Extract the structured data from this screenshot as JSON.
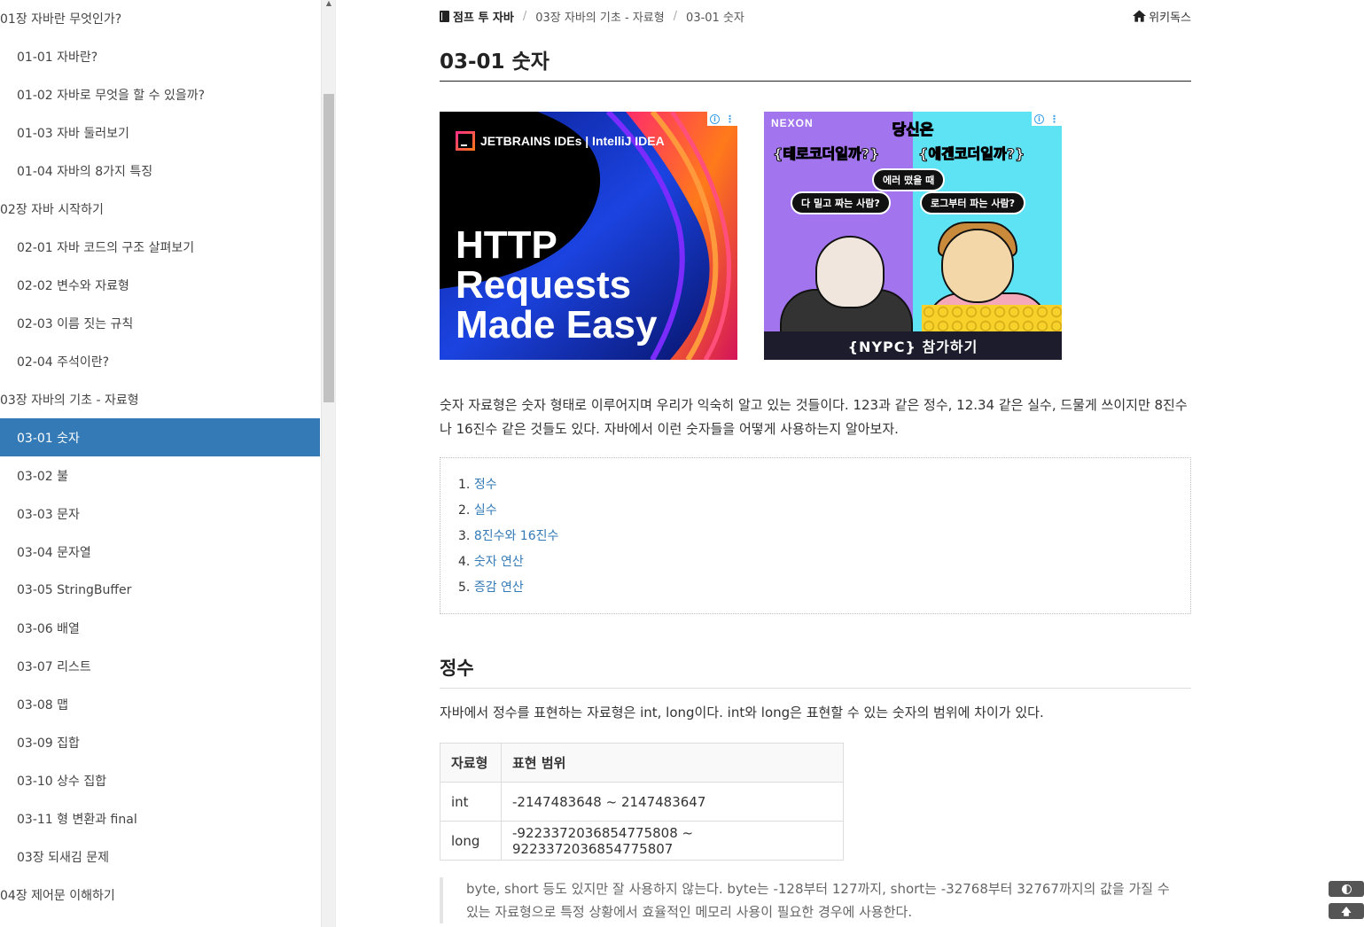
{
  "sidebar": {
    "items": [
      {
        "label": "01장 자바란 무엇인가?",
        "type": "chapter"
      },
      {
        "label": "01-01 자바란?",
        "type": "page"
      },
      {
        "label": "01-02 자바로 무엇을 할 수 있을까?",
        "type": "page"
      },
      {
        "label": "01-03 자바 둘러보기",
        "type": "page"
      },
      {
        "label": "01-04 자바의 8가지 특징",
        "type": "page"
      },
      {
        "label": "02장 자바 시작하기",
        "type": "chapter"
      },
      {
        "label": "02-01 자바 코드의 구조 살펴보기",
        "type": "page"
      },
      {
        "label": "02-02 변수와 자료형",
        "type": "page"
      },
      {
        "label": "02-03 이름 짓는 규칙",
        "type": "page"
      },
      {
        "label": "02-04 주석이란?",
        "type": "page"
      },
      {
        "label": "03장 자바의 기초 - 자료형",
        "type": "chapter"
      },
      {
        "label": "03-01 숫자",
        "type": "page",
        "active": true
      },
      {
        "label": "03-02 불",
        "type": "page"
      },
      {
        "label": "03-03 문자",
        "type": "page"
      },
      {
        "label": "03-04 문자열",
        "type": "page"
      },
      {
        "label": "03-05 StringBuffer",
        "type": "page"
      },
      {
        "label": "03-06 배열",
        "type": "page"
      },
      {
        "label": "03-07 리스트",
        "type": "page"
      },
      {
        "label": "03-08 맵",
        "type": "page"
      },
      {
        "label": "03-09 집합",
        "type": "page"
      },
      {
        "label": "03-10 상수 집합",
        "type": "page"
      },
      {
        "label": "03-11 형 변환과 final",
        "type": "page"
      },
      {
        "label": "03장 되새김 문제",
        "type": "page"
      },
      {
        "label": "04장 제어문 이해하기",
        "type": "chapter"
      }
    ]
  },
  "breadcrumb": {
    "book": "점프 투 자바",
    "chapter": "03장 자바의 기초 - 자료형",
    "page": "03-01 숫자",
    "home_label": "위키독스"
  },
  "page_title": "03-01 숫자",
  "ads": {
    "jetbrains": {
      "brand": "JETBRAINS IDEs  |  IntelliJ IDEA",
      "headline_lines": [
        "HTTP",
        "Requests",
        "Made Easy"
      ]
    },
    "nexon": {
      "brand": "NEXON",
      "title": "당신은",
      "left_question": "{테로코더일까?}",
      "right_question": "{에겐코더일까?}",
      "bubble_mid": "에러 떴을 때",
      "bubble_left": "다 밀고 짜는 사람?",
      "bubble_right": "로그부터 파는 사람?",
      "cta": "{NYPC} 참가하기"
    }
  },
  "intro": "숫자 자료형은 숫자 형태로 이루어지며 우리가 익숙히 알고 있는 것들이다. 123과 같은 정수, 12.34 같은 실수, 드물게 쓰이지만 8진수나 16진수 같은 것들도 있다. 자바에서 이런 숫자들을 어떻게 사용하는지 알아보자.",
  "toc": [
    {
      "num": "1.",
      "label": "정수"
    },
    {
      "num": "2.",
      "label": "실수"
    },
    {
      "num": "3.",
      "label": "8진수와 16진수"
    },
    {
      "num": "4.",
      "label": "숫자 연산"
    },
    {
      "num": "5.",
      "label": "증감 연산"
    }
  ],
  "section": {
    "heading": "정수",
    "paragraph": "자바에서 정수를 표현하는 자료형은 int, long이다. int와 long은 표현할 수 있는 숫자의 범위에 차이가 있다.",
    "table": {
      "headers": [
        "자료형",
        "표현 범위"
      ],
      "rows": [
        [
          "int",
          "-2147483648 ~ 2147483647"
        ],
        [
          "long",
          "-9223372036854775808 ~ 9223372036854775807"
        ]
      ]
    },
    "quote": "byte, short 등도 있지만 잘 사용하지 않는다. byte는 -128부터 127까지, short는 -32768부터 32767까지의 값을 가질 수 있는 자료형으로 특정 상황에서 효율적인 메모리 사용이 필요한 경우에 사용한다."
  },
  "colors": {
    "accent": "#337ab7",
    "active_bg": "#337ab7"
  }
}
